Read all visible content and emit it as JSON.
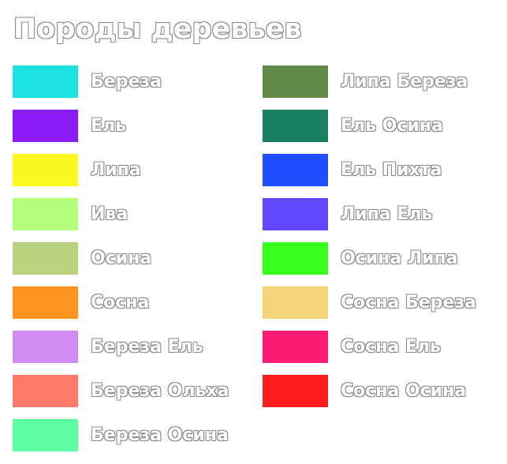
{
  "legend": {
    "title": "Породы деревьев",
    "left_items": [
      {
        "label": "Береза",
        "color": "#1ee2e2"
      },
      {
        "label": "Ель",
        "color": "#8e1cf8"
      },
      {
        "label": "Липа",
        "color": "#fbf820"
      },
      {
        "label": "Ива",
        "color": "#b3fe7a"
      },
      {
        "label": "Осина",
        "color": "#b9d47c"
      },
      {
        "label": "Сосна",
        "color": "#ff9421"
      },
      {
        "label": "Береза Ель",
        "color": "#cf8af4"
      },
      {
        "label": "Береза Ольха",
        "color": "#ff7868"
      },
      {
        "label": "Береза Осина",
        "color": "#5effa2"
      }
    ],
    "right_items": [
      {
        "label": "Липа Береза",
        "color": "#63894a"
      },
      {
        "label": "Ель Осина",
        "color": "#198062"
      },
      {
        "label": "Ель Пихта",
        "color": "#1e4ffe"
      },
      {
        "label": "Липа Ель",
        "color": "#6147fe"
      },
      {
        "label": "Осина Липа",
        "color": "#38fe1e"
      },
      {
        "label": "Сосна Береза",
        "color": "#f5d57a"
      },
      {
        "label": "Сосна Ель",
        "color": "#ff1a75"
      },
      {
        "label": "Сосна Осина",
        "color": "#ff1e1e"
      }
    ]
  }
}
